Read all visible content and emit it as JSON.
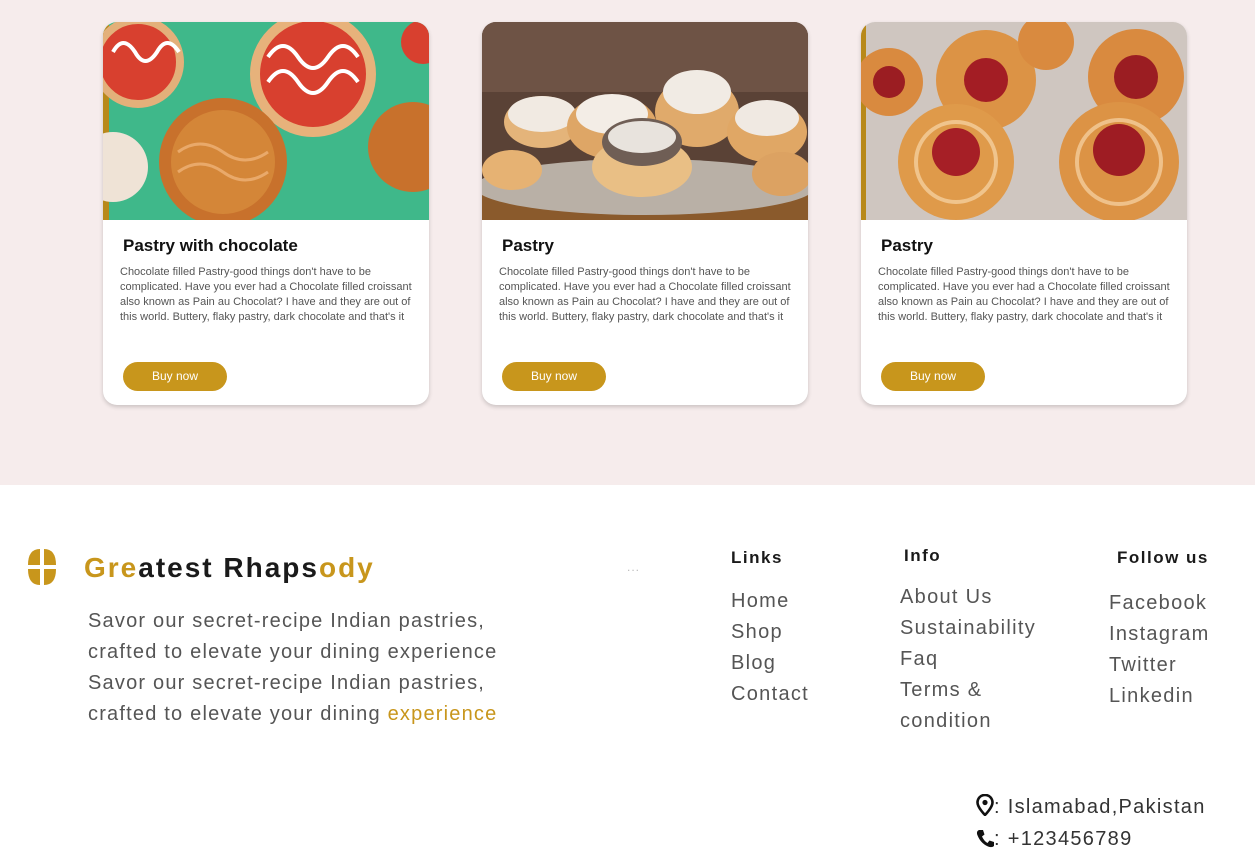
{
  "cards": [
    {
      "title": "Pastry with chocolate",
      "description": "Chocolate filled Pastry-good things don't have to be complicated. Have you ever had a Chocolate filled croissant also known as Pain au Chocolat? I have and they are out of this world. Buttery, flaky pastry, dark chocolate and that's it",
      "button": "Buy now",
      "image": "glazed-pastries-on-green"
    },
    {
      "title": "Pastry",
      "description": "Chocolate filled Pastry-good things don't have to be complicated. Have you ever had a Chocolate filled croissant also known as Pain au Chocolat? I have and they are out of this world. Buttery, flaky pastry, dark chocolate and that's it",
      "button": "Buy now",
      "image": "sugar-dusted-rolls-on-basket"
    },
    {
      "title": "Pastry",
      "description": "Chocolate filled Pastry-good things don't have to be complicated. Have you ever had a Chocolate filled croissant also known as Pain au Chocolat? I have and they are out of this world. Buttery, flaky pastry, dark chocolate and that's it",
      "button": "Buy now",
      "image": "cherry-danish-swirls"
    }
  ],
  "footer": {
    "brand": {
      "part1": "Gre",
      "part2": "atest Rhaps",
      "part3": "ody",
      "logo_icon": "bakery-logo-icon"
    },
    "tagline": {
      "line1": "Savor our secret-recipe Indian pastries,",
      "line2": "crafted to elevate your dining experience",
      "line3": "Savor our secret-recipe Indian pastries,",
      "line4_prefix": "crafted to elevate your dining",
      "line4_highlight": "experience"
    },
    "dots": "...",
    "links": {
      "heading": "Links",
      "items": [
        "Home",
        "Shop",
        "Blog",
        "Contact"
      ]
    },
    "info": {
      "heading": "Info",
      "items": [
        "About Us",
        "Sustainability",
        "Faq",
        "Terms &",
        "condition"
      ]
    },
    "follow": {
      "heading": "Follow us",
      "items": [
        "Facebook",
        "Instagram",
        "Twitter",
        "Linkedin"
      ]
    },
    "contact": {
      "location": ": Islamabad,Pakistan",
      "phone": ":  +123456789",
      "location_icon": "location-pin-icon",
      "phone_icon": "phone-icon"
    }
  },
  "colors": {
    "accent": "#c8961c",
    "top_background": "#f6ecec"
  }
}
